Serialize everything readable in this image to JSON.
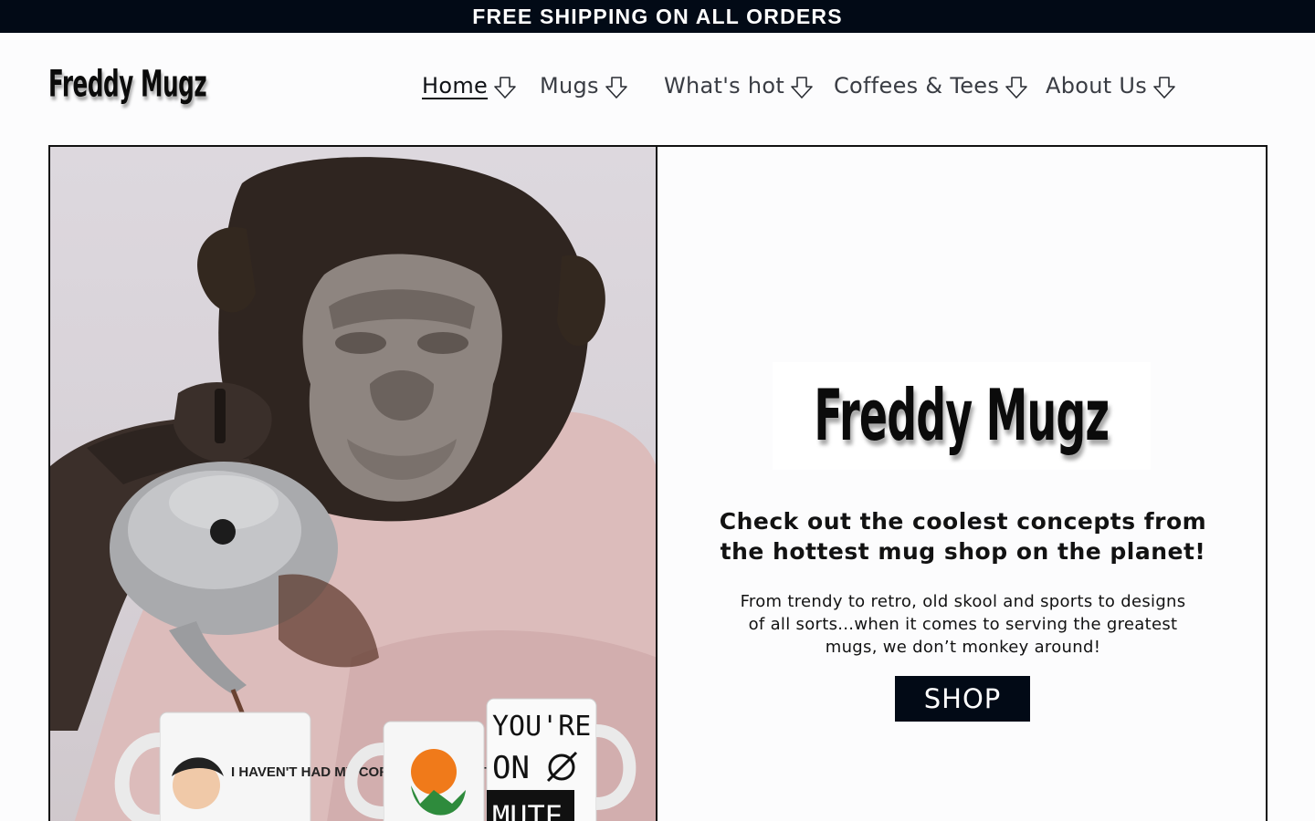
{
  "announcement": {
    "text": "FREE SHIPPING ON ALL ORDERS"
  },
  "header": {
    "logo_text": "Freddy Mugz",
    "nav": [
      {
        "label": "Home",
        "active": true,
        "icon": "arrow-down-icon"
      },
      {
        "label": "Mugs",
        "active": false,
        "icon": "arrow-down-icon"
      },
      {
        "label": "What's hot",
        "active": false,
        "icon": "arrow-down-icon"
      },
      {
        "label": "Coffees & Tees",
        "active": false,
        "icon": "arrow-down-icon"
      },
      {
        "label": "About Us",
        "active": false,
        "icon": "arrow-down-icon"
      }
    ]
  },
  "hero": {
    "image_mugs": {
      "mug1": "I HAVEN'T HAD MY COFFEE YET. DON'T MAKE ME",
      "mug3_line1": "YOU'RE",
      "mug3_line2": "ON",
      "mug3_line3": "MUTE"
    },
    "logo_text": "Freddy Mugz",
    "heading": "Check out the coolest concepts from the hottest mug shop on the planet!",
    "text": "From trendy to retro, old skool and sports to designs of all sorts...when it comes to serving the greatest mugs, we don’t monkey around!",
    "button_label": "SHOP"
  },
  "colors": {
    "announcement_bg": "#020a16",
    "button_bg": "#020a16",
    "page_bg": "#fcfcfd",
    "nav_text": "#3a3d44"
  }
}
